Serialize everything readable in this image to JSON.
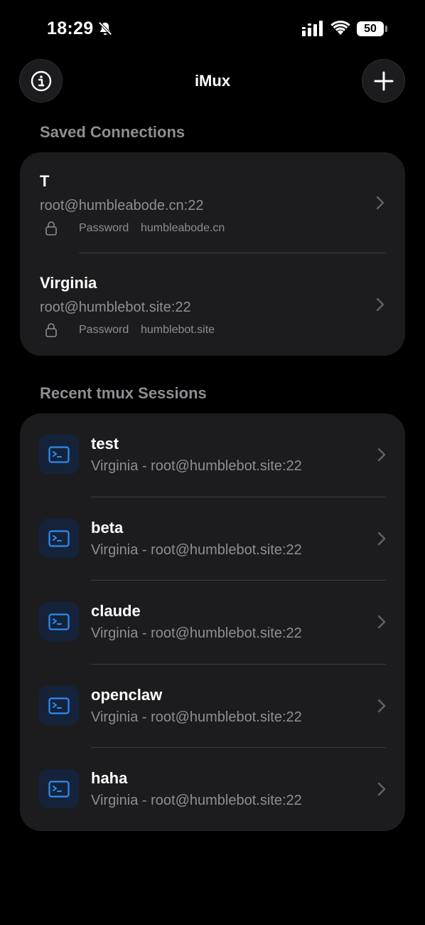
{
  "status_bar": {
    "time": "18:29",
    "battery_level": "50",
    "icons": [
      "bell-slash-icon",
      "cellular-signal-icon",
      "wifi-icon",
      "battery-icon"
    ]
  },
  "nav": {
    "title": "iMux",
    "left_icon": "info-icon",
    "right_icon": "plus-icon"
  },
  "saved_connections": {
    "header": "Saved Connections",
    "items": [
      {
        "name": "T",
        "address": "root@humbleabode.cn:22",
        "auth": "Password",
        "host": "humbleabode.cn"
      },
      {
        "name": "Virginia",
        "address": "root@humblebot.site:22",
        "auth": "Password",
        "host": "humblebot.site"
      }
    ]
  },
  "recent_sessions": {
    "header": "Recent tmux Sessions",
    "items": [
      {
        "name": "test",
        "subtitle": "Virginia - root@humblebot.site:22"
      },
      {
        "name": "beta",
        "subtitle": "Virginia - root@humblebot.site:22"
      },
      {
        "name": "claude",
        "subtitle": "Virginia - root@humblebot.site:22"
      },
      {
        "name": "openclaw",
        "subtitle": "Virginia - root@humblebot.site:22"
      },
      {
        "name": "haha",
        "subtitle": "Virginia - root@humblebot.site:22"
      }
    ]
  },
  "colors": {
    "background": "#000000",
    "card": "#1c1c1e",
    "secondary_text": "#8e8e93",
    "terminal_icon_accent": "#2f8cf2",
    "terminal_icon_bg": "#14233a"
  }
}
